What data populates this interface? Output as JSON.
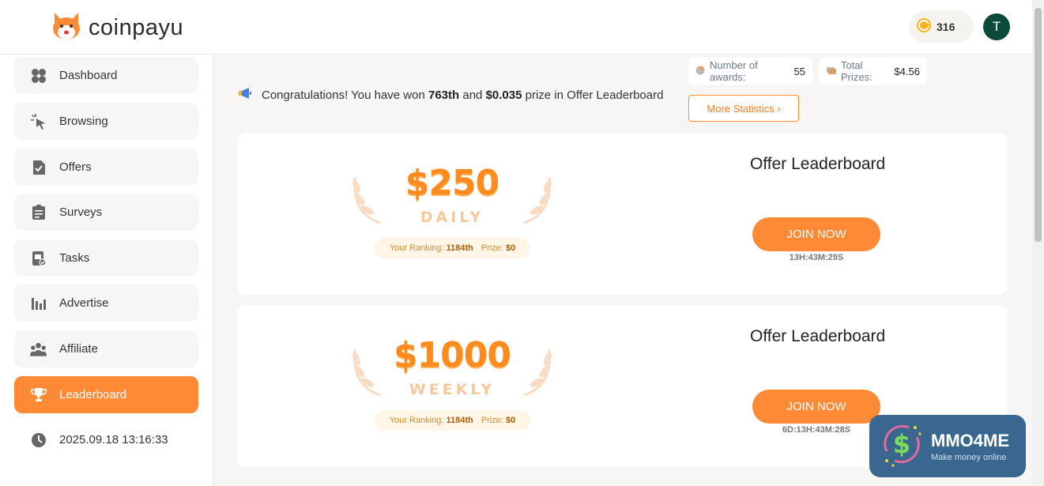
{
  "brand": {
    "name": "coinpayu"
  },
  "header": {
    "coin_balance": "316",
    "avatar_initial": "T"
  },
  "sidebar": {
    "items": [
      {
        "label": "Dashboard",
        "icon": "dashboard-icon"
      },
      {
        "label": "Browsing",
        "icon": "cursor-icon"
      },
      {
        "label": "Offers",
        "icon": "offers-icon"
      },
      {
        "label": "Surveys",
        "icon": "surveys-icon"
      },
      {
        "label": "Tasks",
        "icon": "tasks-icon"
      },
      {
        "label": "Advertise",
        "icon": "advertise-icon"
      },
      {
        "label": "Affiliate",
        "icon": "affiliate-icon"
      },
      {
        "label": "Leaderboard",
        "icon": "trophy-icon",
        "active": true
      }
    ],
    "datetime": "2025.09.18 13:16:33"
  },
  "congrats": {
    "prefix": "Congratulations! You have won",
    "rank": "763th",
    "middle": "and",
    "amount": "$0.035",
    "suffix": "prize in Offer Leaderboard"
  },
  "stats": {
    "awards_label": "Number of awards:",
    "awards_value": "55",
    "prizes_label": "Total Prizes:",
    "prizes_value": "$4.56",
    "more_button": "More Statistics ›"
  },
  "cards": [
    {
      "amount": "$250",
      "period": "DAILY",
      "ranking_label": "Your Ranking:",
      "ranking_value": "1184th",
      "prize_label": "Prize:",
      "prize_value": "$0",
      "title": "Offer Leaderboard",
      "button": "JOIN NOW",
      "timer": "13H:43M:29S"
    },
    {
      "amount": "$1000",
      "period": "WEEKLY",
      "ranking_label": "Your Ranking:",
      "ranking_value": "1184th",
      "prize_label": "Prize:",
      "prize_value": "$0",
      "title": "Offer Leaderboard",
      "button": "JOIN NOW",
      "timer": "6D:13H:43M:28S"
    }
  ],
  "watermark": {
    "title": "MMO4ME",
    "subtitle": "Make money online"
  },
  "colors": {
    "accent": "#ff8a35",
    "avatar_bg": "#0c4a3a",
    "watermark_bg": "#3a6790"
  }
}
